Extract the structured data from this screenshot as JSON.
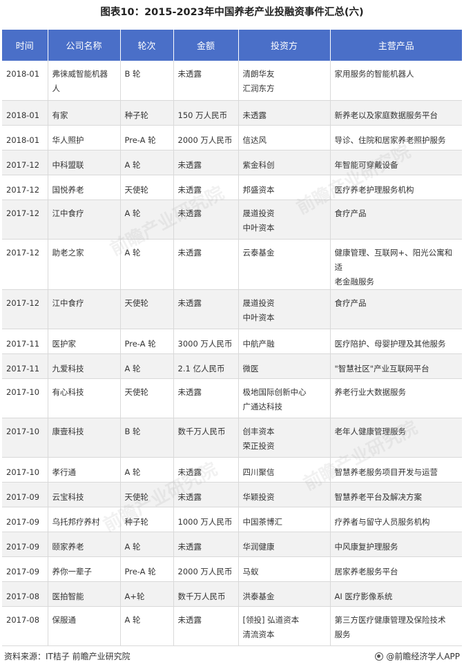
{
  "title": "图表10：2015-2023年中国养老产业投融资事件汇总(六)",
  "columns": [
    "时间",
    "公司名称",
    "轮次",
    "金额",
    "投资方",
    "主营产品"
  ],
  "rows": [
    {
      "time": "2018-01",
      "company": [
        "弗徕威智能机器",
        "人"
      ],
      "round": "B 轮",
      "amount": "未透露",
      "investor": [
        "清朗华友",
        "汇润东方"
      ],
      "product": [
        "家用服务的智能机器人"
      ]
    },
    {
      "time": "2018-01",
      "company": [
        "有家"
      ],
      "round": "种子轮",
      "amount": "150 万人民币",
      "investor": [
        "未透露"
      ],
      "product": [
        "新养老以及家庭数据服务平台"
      ]
    },
    {
      "time": "2018-01",
      "company": [
        "华人照护"
      ],
      "round": "Pre-A 轮",
      "amount": "2000 万人民币",
      "investor": [
        "信达风"
      ],
      "product": [
        "导诊、住院和居家养老照护服务"
      ]
    },
    {
      "time": "2017-12",
      "company": [
        "中科盟联"
      ],
      "round": "A 轮",
      "amount": "未透露",
      "investor": [
        "紫金科创"
      ],
      "product": [
        "年智能可穿戴设备"
      ]
    },
    {
      "time": "2017-12",
      "company": [
        "国悦养老"
      ],
      "round": "天使轮",
      "amount": "未透露",
      "investor": [
        "邦盛资本"
      ],
      "product": [
        "医疗养老护理服务机构"
      ]
    },
    {
      "time": "2017-12",
      "company": [
        "江中食疗"
      ],
      "round": "A 轮",
      "amount": "未透露",
      "investor": [
        "晟道投资",
        "中叶资本"
      ],
      "product": [
        "食疗产品"
      ]
    },
    {
      "time": "2017-12",
      "company": [
        "助老之家"
      ],
      "round": "A 轮",
      "amount": "未透露",
      "investor": [
        "云泰基金"
      ],
      "product": [
        "健康管理、互联网+、阳光公寓和适",
        "老金融服务"
      ]
    },
    {
      "time": "2017-12",
      "company": [
        "江中食疗"
      ],
      "round": "天使轮",
      "amount": "未透露",
      "investor": [
        "晟道投资",
        "中叶资本"
      ],
      "product": [
        "食疗产品"
      ]
    },
    {
      "time": "2017-11",
      "company": [
        "医护家"
      ],
      "round": "Pre-A 轮",
      "amount": "3000 万人民币",
      "investor": [
        "中航产融"
      ],
      "product": [
        "医疗陪护、母婴护理及其他服务"
      ]
    },
    {
      "time": "2017-11",
      "company": [
        "九爱科技"
      ],
      "round": "A 轮",
      "amount": "2.1 亿人民币",
      "investor": [
        "微医"
      ],
      "product": [
        "\"智慧社区\"产业互联网平台"
      ]
    },
    {
      "time": "2017-10",
      "company": [
        "有心科技"
      ],
      "round": "天使轮",
      "amount": "未透露",
      "investor": [
        "极地国际创新中心",
        "广通达科技"
      ],
      "product": [
        "养老行业大数据服务"
      ]
    },
    {
      "time": "2017-10",
      "company": [
        "康壹科技"
      ],
      "round": "B 轮",
      "amount": "数千万人民币",
      "investor": [
        "创丰资本",
        "荣正投资"
      ],
      "product": [
        "老年人健康管理服务"
      ]
    },
    {
      "time": "2017-10",
      "company": [
        "孝行通"
      ],
      "round": "A 轮",
      "amount": "未透露",
      "investor": [
        "四川聚信"
      ],
      "product": [
        "智慧养老服务项目开发与运营"
      ]
    },
    {
      "time": "2017-09",
      "company": [
        "云宝科技"
      ],
      "round": "天使轮",
      "amount": "未透露",
      "investor": [
        "华颖投资"
      ],
      "product": [
        "智慧养老平台及解决方案"
      ]
    },
    {
      "time": "2017-09",
      "company": [
        "乌托邦疗养村"
      ],
      "round": "种子轮",
      "amount": "1000 万人民币",
      "investor": [
        "中国茶博汇"
      ],
      "product": [
        "疗养者与留守人员服务机构"
      ]
    },
    {
      "time": "2017-09",
      "company": [
        "颐家养老"
      ],
      "round": "A 轮",
      "amount": "未透露",
      "investor": [
        "华润健康"
      ],
      "product": [
        "中风康复护理服务"
      ]
    },
    {
      "time": "2017-09",
      "company": [
        "养你一辈子"
      ],
      "round": "Pre-A 轮",
      "amount": "2000 万人民币",
      "investor": [
        "马蚁"
      ],
      "product": [
        "居家养老服务平台"
      ]
    },
    {
      "time": "2017-08",
      "company": [
        "医拍智能"
      ],
      "round": "A+轮",
      "amount": "数千万人民币",
      "investor": [
        "洪泰基金"
      ],
      "product": [
        "AI 医疗影像系统"
      ]
    },
    {
      "time": "2017-08",
      "company": [
        "保服通"
      ],
      "round": "A 轮",
      "amount": "未透露",
      "investor": [
        "[领投] 弘道资本",
        "清流资本"
      ],
      "product": [
        "第三方医疗健康管理及保险技术",
        "服务"
      ]
    }
  ],
  "footer": {
    "source": "资料来源：IT桔子 前瞻产业研究院",
    "brand": "@前瞻经济学人APP"
  },
  "watermark": "前瞻产业研究院"
}
